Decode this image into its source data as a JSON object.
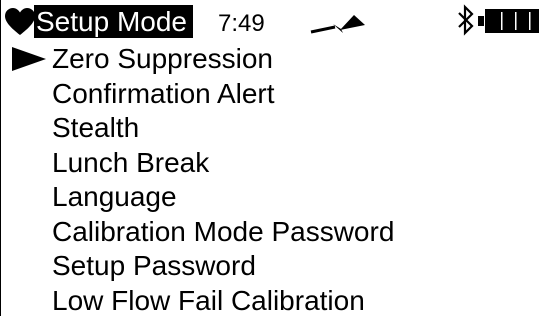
{
  "status": {
    "mode_title": "Setup Mode",
    "time": "7:49",
    "icons": {
      "heart": "heart-icon",
      "signal": "signal-icon",
      "bluetooth": "bluetooth-icon",
      "battery": "battery-icon"
    },
    "battery_level": 1.0
  },
  "menu": {
    "selected_index": 0,
    "items": [
      {
        "label": "Zero Suppression"
      },
      {
        "label": "Confirmation Alert"
      },
      {
        "label": "Stealth"
      },
      {
        "label": "Lunch Break"
      },
      {
        "label": "Language"
      },
      {
        "label": "Calibration Mode Password"
      },
      {
        "label": "Setup Password"
      },
      {
        "label": "Low Flow Fail Calibration"
      }
    ]
  },
  "colors": {
    "foreground": "#000000",
    "background": "#ffffff"
  }
}
